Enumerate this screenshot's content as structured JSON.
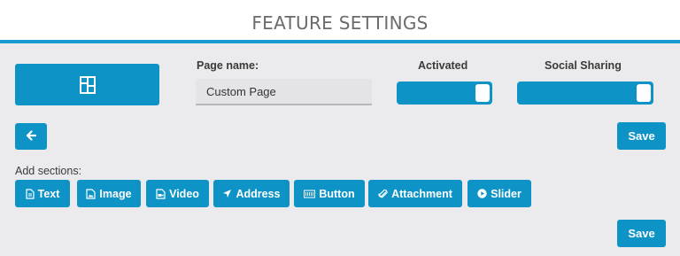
{
  "header": {
    "title": "FEATURE SETTINGS"
  },
  "colors": {
    "accent": "#0e93c6",
    "header_border": "#1a9bd0",
    "background": "#ebebed"
  },
  "layout_button": {
    "icon": "layout-icon"
  },
  "page_name": {
    "label": "Page name:",
    "value": "Custom Page"
  },
  "activated": {
    "label": "Activated",
    "state": true
  },
  "social_sharing": {
    "label": "Social Sharing",
    "state": true
  },
  "back_button": {
    "icon": "arrow-left-icon",
    "glyph": "🡐"
  },
  "save_top": {
    "label": "Save"
  },
  "add_sections": {
    "label": "Add sections:",
    "items": [
      {
        "label": "Text",
        "icon": "document-icon"
      },
      {
        "label": "Image",
        "icon": "image-icon"
      },
      {
        "label": "Video",
        "icon": "video-icon"
      },
      {
        "label": "Address",
        "icon": "location-arrow-icon"
      },
      {
        "label": "Button",
        "icon": "button-icon"
      },
      {
        "label": "Attachment",
        "icon": "paperclip-icon"
      },
      {
        "label": "Slider",
        "icon": "play-circle-icon"
      }
    ]
  },
  "save_bottom": {
    "label": "Save"
  }
}
